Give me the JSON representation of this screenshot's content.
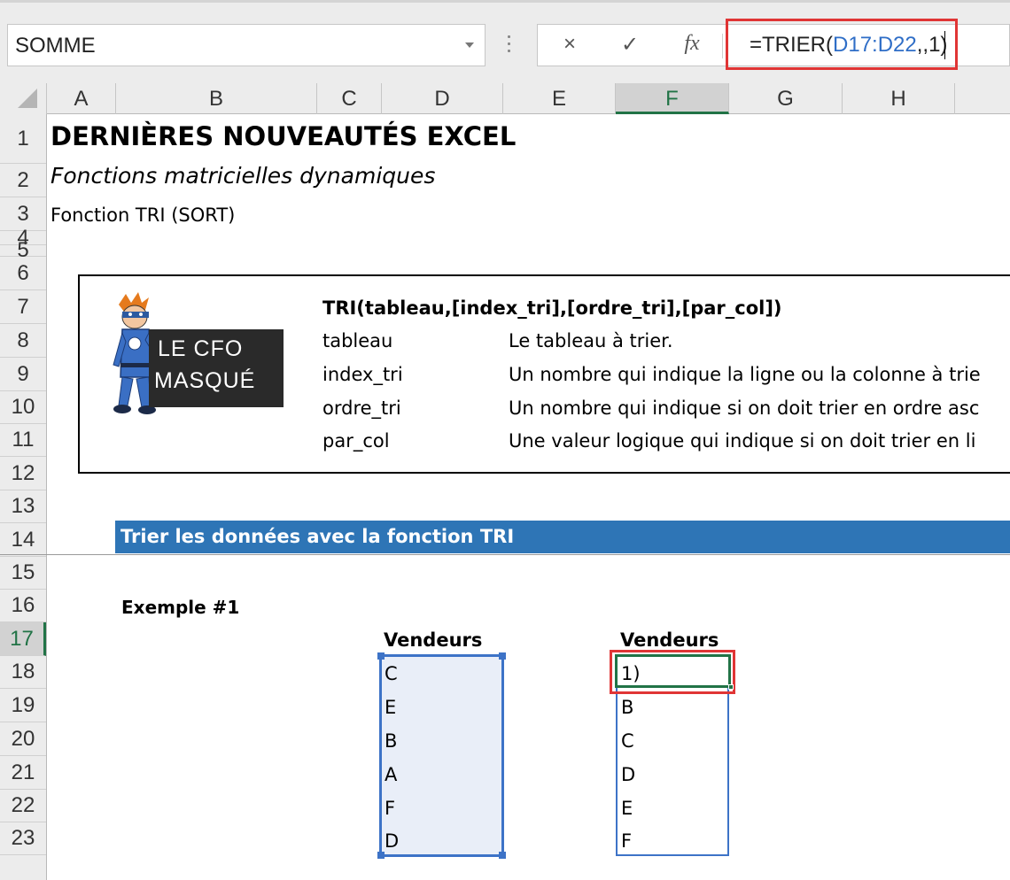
{
  "formula_bar": {
    "name_box": "SOMME",
    "cancel_icon": "×",
    "enter_icon": "✓",
    "fx_label": "fx",
    "formula_prefix": "=TRIER(",
    "formula_ref": "D17:D22",
    "formula_suffix": ",,1)"
  },
  "columns": [
    "A",
    "B",
    "C",
    "D",
    "E",
    "F",
    "G",
    "H"
  ],
  "rows": [
    "1",
    "2",
    "3",
    "4",
    "5",
    "6",
    "7",
    "8",
    "9",
    "10",
    "11",
    "12",
    "13",
    "14",
    "15",
    "16",
    "17",
    "18",
    "19",
    "20",
    "21",
    "22",
    "23"
  ],
  "selected_column": "F",
  "selected_row": "17",
  "sheet": {
    "title": "DERNIÈRES NOUVEAUTÉS EXCEL",
    "subtitle": "Fonctions matricielles dynamiques",
    "function_label": "Fonction TRI (SORT)",
    "logo_line1": "LE CFO",
    "logo_line2": "MASQUÉ",
    "syntax": "TRI(tableau,[index_tri],[ordre_tri],[par_col])",
    "params": [
      {
        "name": "tableau",
        "desc": "Le tableau à trier."
      },
      {
        "name": "index_tri",
        "desc": "Un nombre qui indique la ligne ou la colonne à trie"
      },
      {
        "name": "ordre_tri",
        "desc": "Un nombre qui indique si on doit trier en ordre asc"
      },
      {
        "name": "par_col",
        "desc": "Une valeur logique qui indique si on doit trier en li"
      }
    ],
    "section_title": "Trier les données avec la fonction TRI",
    "example_label": "Exemple #1",
    "source_header": "Vendeurs",
    "result_header": "Vendeurs",
    "source_values": [
      "C",
      "E",
      "B",
      "A",
      "F",
      "D"
    ],
    "result_values": [
      "1)",
      "B",
      "C",
      "D",
      "E",
      "F"
    ]
  },
  "colors": {
    "accent_green": "#217346",
    "highlight_red": "#e03535",
    "range_blue": "#3d73c7",
    "section_blue": "#2e75b6"
  }
}
